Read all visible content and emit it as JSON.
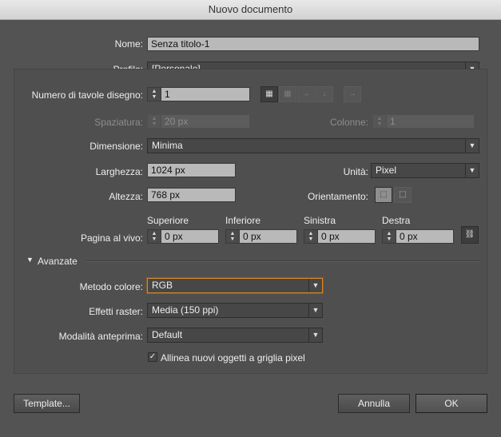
{
  "window": {
    "title": "Nuovo documento"
  },
  "name": {
    "label": "Nome:",
    "value": "Senza titolo-1"
  },
  "profile": {
    "label": "Profilo:",
    "value": "[Personale]"
  },
  "artboards": {
    "label": "Numero di tavole disegno:",
    "value": "1"
  },
  "spacing": {
    "label": "Spaziatura:",
    "value": "20 px"
  },
  "columns": {
    "label": "Colonne:",
    "value": "1"
  },
  "size": {
    "label": "Dimensione:",
    "value": "Minima"
  },
  "width": {
    "label": "Larghezza:",
    "value": "1024 px"
  },
  "height": {
    "label": "Altezza:",
    "value": "768 px"
  },
  "units": {
    "label": "Unità:",
    "value": "Pixel"
  },
  "orientation": {
    "label": "Orientamento:"
  },
  "bleed": {
    "label": "Pagina al vivo:",
    "top_label": "Superiore",
    "top_value": "0 px",
    "bottom_label": "Inferiore",
    "bottom_value": "0 px",
    "left_label": "Sinistra",
    "left_value": "0 px",
    "right_label": "Destra",
    "right_value": "0 px"
  },
  "advanced": {
    "label": "Avanzate",
    "color_mode_label": "Metodo colore:",
    "color_mode_value": "RGB",
    "raster_label": "Effetti raster:",
    "raster_value": "Media (150 ppi)",
    "preview_label": "Modalità anteprima:",
    "preview_value": "Default",
    "align_label": "Allinea nuovi oggetti a griglia pixel",
    "align_checked": true
  },
  "buttons": {
    "templates": "Template...",
    "cancel": "Annulla",
    "ok": "OK"
  },
  "colors": {
    "focus": "#d9882a",
    "background": "#535353"
  }
}
